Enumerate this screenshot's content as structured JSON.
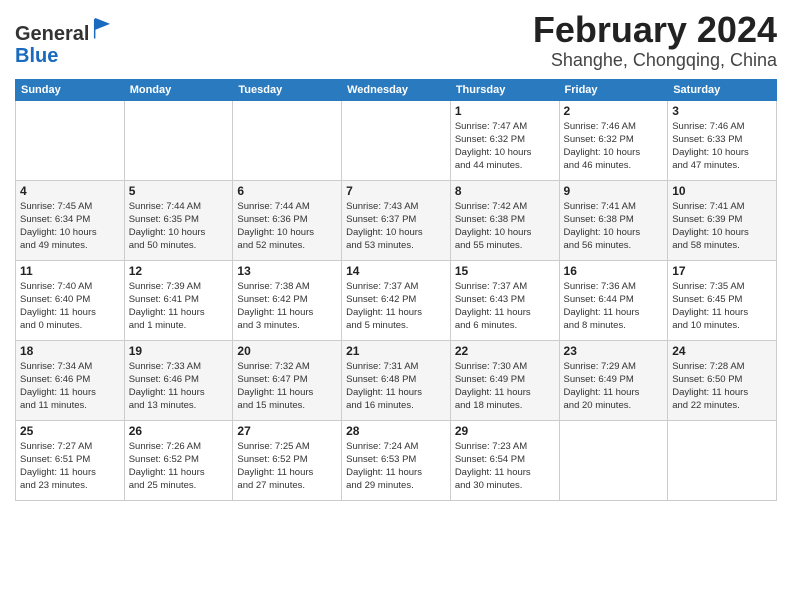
{
  "header": {
    "logo_line1": "General",
    "logo_line2": "Blue",
    "month": "February 2024",
    "location": "Shanghe, Chongqing, China"
  },
  "weekdays": [
    "Sunday",
    "Monday",
    "Tuesday",
    "Wednesday",
    "Thursday",
    "Friday",
    "Saturday"
  ],
  "weeks": [
    [
      {
        "day": "",
        "info": ""
      },
      {
        "day": "",
        "info": ""
      },
      {
        "day": "",
        "info": ""
      },
      {
        "day": "",
        "info": ""
      },
      {
        "day": "1",
        "info": "Sunrise: 7:47 AM\nSunset: 6:32 PM\nDaylight: 10 hours\nand 44 minutes."
      },
      {
        "day": "2",
        "info": "Sunrise: 7:46 AM\nSunset: 6:32 PM\nDaylight: 10 hours\nand 46 minutes."
      },
      {
        "day": "3",
        "info": "Sunrise: 7:46 AM\nSunset: 6:33 PM\nDaylight: 10 hours\nand 47 minutes."
      }
    ],
    [
      {
        "day": "4",
        "info": "Sunrise: 7:45 AM\nSunset: 6:34 PM\nDaylight: 10 hours\nand 49 minutes."
      },
      {
        "day": "5",
        "info": "Sunrise: 7:44 AM\nSunset: 6:35 PM\nDaylight: 10 hours\nand 50 minutes."
      },
      {
        "day": "6",
        "info": "Sunrise: 7:44 AM\nSunset: 6:36 PM\nDaylight: 10 hours\nand 52 minutes."
      },
      {
        "day": "7",
        "info": "Sunrise: 7:43 AM\nSunset: 6:37 PM\nDaylight: 10 hours\nand 53 minutes."
      },
      {
        "day": "8",
        "info": "Sunrise: 7:42 AM\nSunset: 6:38 PM\nDaylight: 10 hours\nand 55 minutes."
      },
      {
        "day": "9",
        "info": "Sunrise: 7:41 AM\nSunset: 6:38 PM\nDaylight: 10 hours\nand 56 minutes."
      },
      {
        "day": "10",
        "info": "Sunrise: 7:41 AM\nSunset: 6:39 PM\nDaylight: 10 hours\nand 58 minutes."
      }
    ],
    [
      {
        "day": "11",
        "info": "Sunrise: 7:40 AM\nSunset: 6:40 PM\nDaylight: 11 hours\nand 0 minutes."
      },
      {
        "day": "12",
        "info": "Sunrise: 7:39 AM\nSunset: 6:41 PM\nDaylight: 11 hours\nand 1 minute."
      },
      {
        "day": "13",
        "info": "Sunrise: 7:38 AM\nSunset: 6:42 PM\nDaylight: 11 hours\nand 3 minutes."
      },
      {
        "day": "14",
        "info": "Sunrise: 7:37 AM\nSunset: 6:42 PM\nDaylight: 11 hours\nand 5 minutes."
      },
      {
        "day": "15",
        "info": "Sunrise: 7:37 AM\nSunset: 6:43 PM\nDaylight: 11 hours\nand 6 minutes."
      },
      {
        "day": "16",
        "info": "Sunrise: 7:36 AM\nSunset: 6:44 PM\nDaylight: 11 hours\nand 8 minutes."
      },
      {
        "day": "17",
        "info": "Sunrise: 7:35 AM\nSunset: 6:45 PM\nDaylight: 11 hours\nand 10 minutes."
      }
    ],
    [
      {
        "day": "18",
        "info": "Sunrise: 7:34 AM\nSunset: 6:46 PM\nDaylight: 11 hours\nand 11 minutes."
      },
      {
        "day": "19",
        "info": "Sunrise: 7:33 AM\nSunset: 6:46 PM\nDaylight: 11 hours\nand 13 minutes."
      },
      {
        "day": "20",
        "info": "Sunrise: 7:32 AM\nSunset: 6:47 PM\nDaylight: 11 hours\nand 15 minutes."
      },
      {
        "day": "21",
        "info": "Sunrise: 7:31 AM\nSunset: 6:48 PM\nDaylight: 11 hours\nand 16 minutes."
      },
      {
        "day": "22",
        "info": "Sunrise: 7:30 AM\nSunset: 6:49 PM\nDaylight: 11 hours\nand 18 minutes."
      },
      {
        "day": "23",
        "info": "Sunrise: 7:29 AM\nSunset: 6:49 PM\nDaylight: 11 hours\nand 20 minutes."
      },
      {
        "day": "24",
        "info": "Sunrise: 7:28 AM\nSunset: 6:50 PM\nDaylight: 11 hours\nand 22 minutes."
      }
    ],
    [
      {
        "day": "25",
        "info": "Sunrise: 7:27 AM\nSunset: 6:51 PM\nDaylight: 11 hours\nand 23 minutes."
      },
      {
        "day": "26",
        "info": "Sunrise: 7:26 AM\nSunset: 6:52 PM\nDaylight: 11 hours\nand 25 minutes."
      },
      {
        "day": "27",
        "info": "Sunrise: 7:25 AM\nSunset: 6:52 PM\nDaylight: 11 hours\nand 27 minutes."
      },
      {
        "day": "28",
        "info": "Sunrise: 7:24 AM\nSunset: 6:53 PM\nDaylight: 11 hours\nand 29 minutes."
      },
      {
        "day": "29",
        "info": "Sunrise: 7:23 AM\nSunset: 6:54 PM\nDaylight: 11 hours\nand 30 minutes."
      },
      {
        "day": "",
        "info": ""
      },
      {
        "day": "",
        "info": ""
      }
    ]
  ]
}
